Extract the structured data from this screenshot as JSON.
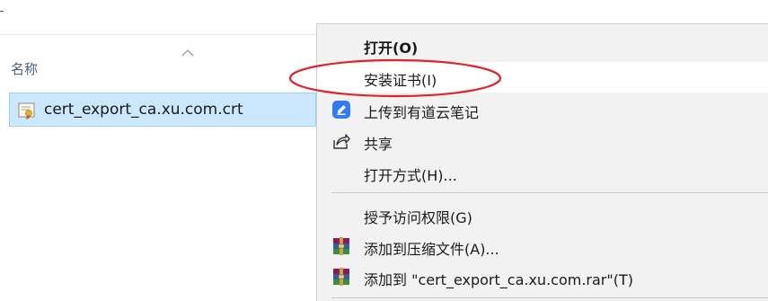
{
  "file_list": {
    "column_name": "名称",
    "file_name": "cert_export_ca.xu.com.crt"
  },
  "context_menu": {
    "items": [
      {
        "label": "打开(O)",
        "icon": "none",
        "bold": true
      },
      {
        "label": "安装证书(I)",
        "icon": "none",
        "highlighted": true
      },
      {
        "label": "上传到有道云笔记",
        "icon": "youdao-note-icon"
      },
      {
        "label": "共享",
        "icon": "share-icon"
      },
      {
        "label": "打开方式(H)...",
        "icon": "none"
      },
      {
        "label": "授予访问权限(G)",
        "icon": "none"
      },
      {
        "label": "添加到压缩文件(A)...",
        "icon": "winrar-icon"
      },
      {
        "label": "添加到 \"cert_export_ca.xu.com.rar\"(T)",
        "icon": "winrar-icon"
      }
    ]
  },
  "annotation": {
    "color": "#e0242b",
    "shape": "ellipse"
  },
  "colors": {
    "selection_bg": "#cce8ff",
    "selection_border": "#99d1ff",
    "menu_bg": "#f2f2f2",
    "youdao_blue": "#2f7cf6"
  }
}
